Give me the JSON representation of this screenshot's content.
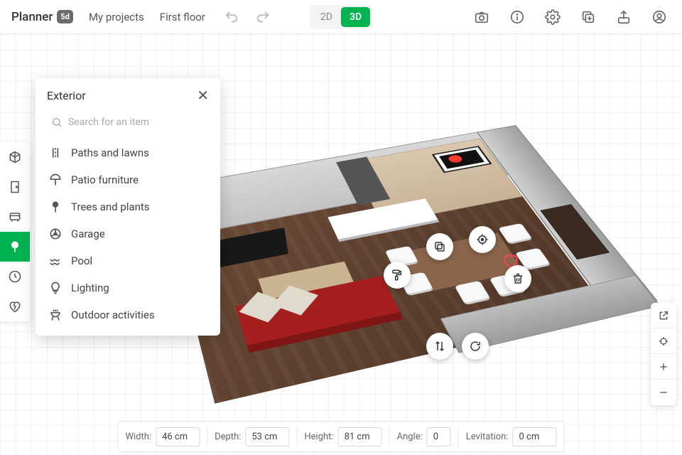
{
  "brand": {
    "name": "Planner",
    "badge": "5d"
  },
  "nav": {
    "projects": "My projects",
    "floor": "First floor"
  },
  "view": {
    "two_d": "2D",
    "three_d": "3D",
    "active": "3D"
  },
  "panel": {
    "title": "Exterior",
    "search_placeholder": "Search for an item",
    "categories": [
      {
        "label": "Paths and lawns"
      },
      {
        "label": "Patio furniture"
      },
      {
        "label": "Trees and plants"
      },
      {
        "label": "Garage"
      },
      {
        "label": "Pool"
      },
      {
        "label": "Lighting"
      },
      {
        "label": "Outdoor activities"
      }
    ]
  },
  "dimensions": {
    "width_label": "Width:",
    "width_value": "46 cm",
    "depth_label": "Depth:",
    "depth_value": "53 cm",
    "height_label": "Height:",
    "height_value": "81 cm",
    "angle_label": "Angle:",
    "angle_value": "0",
    "levitation_label": "Levitation:",
    "levitation_value": "0 cm"
  }
}
